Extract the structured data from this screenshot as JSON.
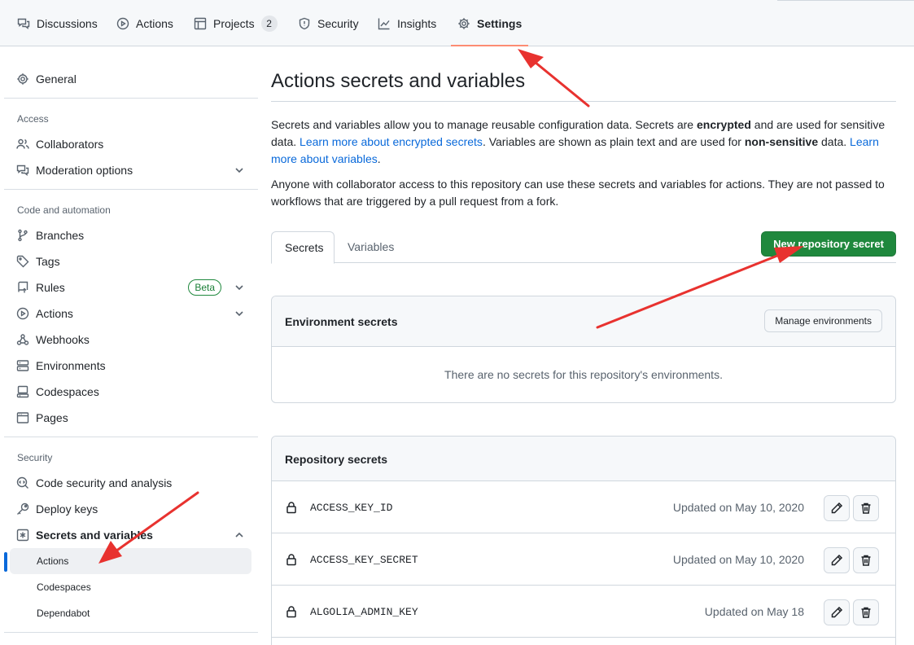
{
  "nav": {
    "tabs": [
      {
        "label": "Discussions",
        "icon": "comment-discussion-icon"
      },
      {
        "label": "Actions",
        "icon": "play-icon"
      },
      {
        "label": "Projects",
        "icon": "table-icon",
        "count": "2"
      },
      {
        "label": "Security",
        "icon": "shield-icon"
      },
      {
        "label": "Insights",
        "icon": "graph-icon"
      },
      {
        "label": "Settings",
        "icon": "gear-icon",
        "selected": true
      }
    ]
  },
  "sidebar": {
    "general": "General",
    "access_heading": "Access",
    "collaborators": "Collaborators",
    "moderation": "Moderation options",
    "code_heading": "Code and automation",
    "branches": "Branches",
    "tags": "Tags",
    "rules": "Rules",
    "rules_badge": "Beta",
    "actions": "Actions",
    "webhooks": "Webhooks",
    "environments": "Environments",
    "codespaces": "Codespaces",
    "pages": "Pages",
    "security_heading": "Security",
    "code_security": "Code security and analysis",
    "deploy_keys": "Deploy keys",
    "secrets_vars": "Secrets and variables",
    "sub_actions": "Actions",
    "sub_codespaces": "Codespaces",
    "sub_dependabot": "Dependabot"
  },
  "main": {
    "title": "Actions secrets and variables",
    "p1_a": "Secrets and variables allow you to manage reusable configuration data. Secrets are ",
    "p1_b": "encrypted",
    "p1_c": " and are used for sensitive data. ",
    "p1_link1": "Learn more about encrypted secrets",
    "p1_d": ". Variables are shown as plain text and are used for ",
    "p1_e": "non-sensitive",
    "p1_f": " data. ",
    "p1_link2": "Learn more about variables",
    "p1_g": ".",
    "p2": "Anyone with collaborator access to this repository can use these secrets and variables for actions. They are not passed to workflows that are triggered by a pull request from a fork.",
    "tab_secrets": "Secrets",
    "tab_variables": "Variables",
    "new_secret_button": "New repository secret",
    "env_title": "Environment secrets",
    "manage_env_button": "Manage environments",
    "env_empty": "There are no secrets for this repository's environments.",
    "repo_title": "Repository secrets",
    "secrets": [
      {
        "name": "ACCESS_KEY_ID",
        "updated": "Updated on May 10, 2020"
      },
      {
        "name": "ACCESS_KEY_SECRET",
        "updated": "Updated on May 10, 2020"
      },
      {
        "name": "ALGOLIA_ADMIN_KEY",
        "updated": "Updated on May 18"
      }
    ]
  },
  "colors": {
    "primary_button": "#1f883d",
    "link": "#0969da",
    "selected_tab_underline": "#fd8c73",
    "annotation_arrow": "#e8322f"
  }
}
